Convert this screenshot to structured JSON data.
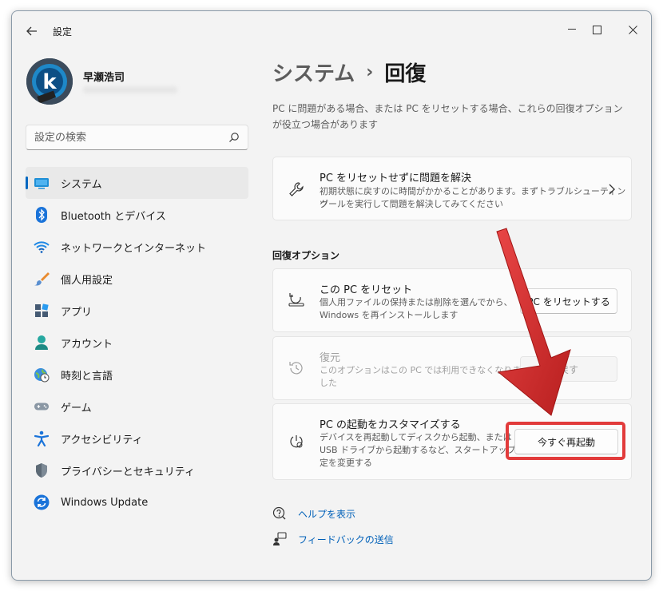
{
  "window": {
    "title": "設定"
  },
  "user": {
    "name": "早瀬浩司",
    "avatar_letter": "k"
  },
  "search": {
    "placeholder": "設定の検索"
  },
  "sidebar": {
    "items": [
      {
        "label": "システム",
        "icon": "system-icon",
        "active": true
      },
      {
        "label": "Bluetooth とデバイス",
        "icon": "bluetooth-icon"
      },
      {
        "label": "ネットワークとインターネット",
        "icon": "wifi-icon"
      },
      {
        "label": "個人用設定",
        "icon": "brush-icon"
      },
      {
        "label": "アプリ",
        "icon": "apps-icon"
      },
      {
        "label": "アカウント",
        "icon": "account-icon"
      },
      {
        "label": "時刻と言語",
        "icon": "globe-clock-icon"
      },
      {
        "label": "ゲーム",
        "icon": "gamepad-icon"
      },
      {
        "label": "アクセシビリティ",
        "icon": "accessibility-icon"
      },
      {
        "label": "プライバシーとセキュリティ",
        "icon": "shield-icon"
      },
      {
        "label": "Windows Update",
        "icon": "update-icon"
      }
    ]
  },
  "breadcrumb": {
    "parent": "システム",
    "separator": "›",
    "current": "回復"
  },
  "intro": "PC に問題がある場合、または PC をリセットする場合、これらの回復オプションが役立つ場合があります",
  "troubleshoot_card": {
    "title": "PC をリセットせずに問題を解決",
    "desc_line1": "初期状態に戻すのに時間がかかることがあります。まずトラブルシューティング",
    "desc_line2": "ツールを実行して問題を解決してみてください"
  },
  "section_title": "回復オプション",
  "options": {
    "reset": {
      "title": "この PC をリセット",
      "desc_line1": "個人用ファイルの保持または削除を選んでから、",
      "desc_line2": "Windows を再インストールします",
      "button": "PC をリセットする"
    },
    "restore": {
      "title": "復元",
      "desc_line1": "このオプションはこの PC では利用できなくなりま",
      "desc_line2": "した",
      "button": "戻す"
    },
    "startup": {
      "title": "PC の起動をカスタマイズする",
      "desc_line1": "デバイスを再起動してディスクから起動、または",
      "desc_line2": "USB ドライブから起動するなど、スタートアップ設",
      "desc_line3": "定を変更する",
      "button": "今すぐ再起動"
    }
  },
  "links": {
    "help": "ヘルプを表示",
    "feedback": "フィードバックの送信"
  },
  "colors": {
    "accent": "#0067c0",
    "annotation_red": "#e23b3b"
  }
}
